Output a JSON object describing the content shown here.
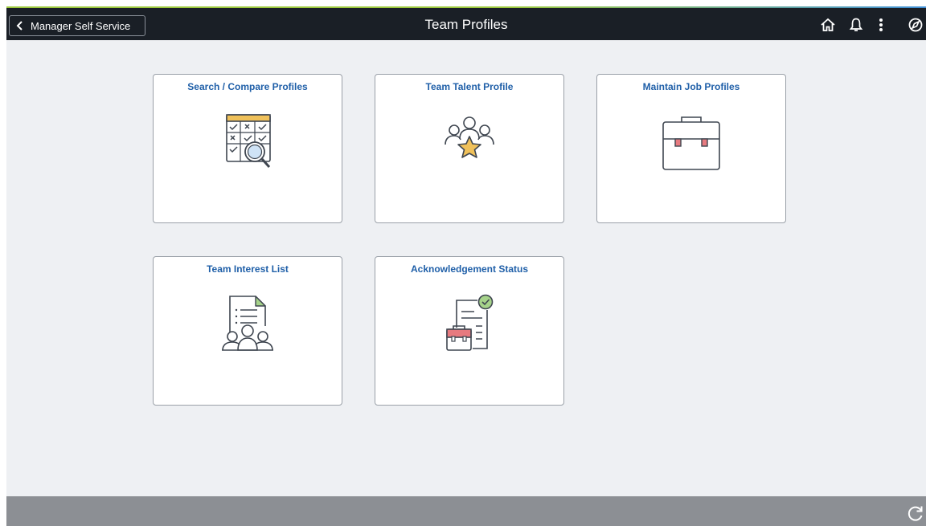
{
  "header": {
    "back_label": "Manager Self Service",
    "title": "Team Profiles",
    "icons": [
      "home-icon",
      "bell-icon",
      "more-vertical-icon",
      "navbar-icon"
    ]
  },
  "tiles": [
    {
      "title": "Search / Compare Profiles",
      "icon": "checklist-search-icon"
    },
    {
      "title": "Team Talent Profile",
      "icon": "team-star-icon"
    },
    {
      "title": "Maintain Job Profiles",
      "icon": "briefcase-icon"
    },
    {
      "title": "Team Interest List",
      "icon": "document-team-icon"
    },
    {
      "title": "Acknowledgement Status",
      "icon": "document-check-briefcase-icon"
    }
  ],
  "footer": {
    "icon": "refresh-icon"
  },
  "colors": {
    "header_bg": "#1a1f26",
    "tile_title": "#1f5fa8",
    "content_bg": "#eef0f3",
    "footer_bg": "#8c8f94",
    "accent_green": "#9bc83c",
    "accent_blue": "#3f8fd6"
  }
}
